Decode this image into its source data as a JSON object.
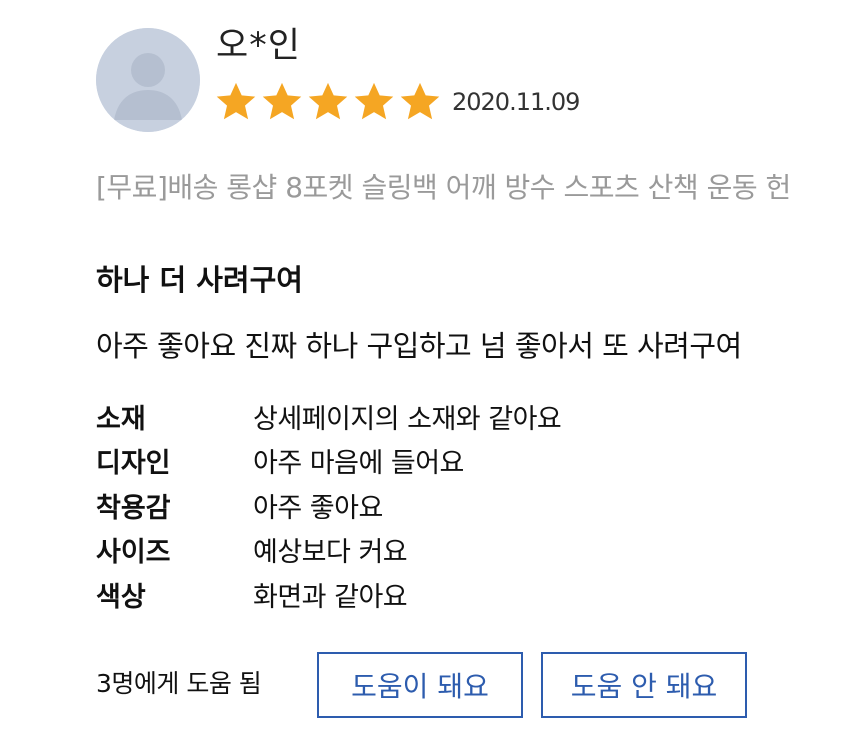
{
  "review": {
    "user_name": "오*인",
    "rating": 5,
    "max_rating": 5,
    "date": "2020.11.09",
    "product_name": "[무료]배송 롱샵 8포켓 슬링백 어깨 방수 스포츠 산책 운동 헌",
    "headline": "하나 더 사려구여",
    "body": "아주 좋아요 진짜 하나 구입하고 넘 좋아서 또 사려구여",
    "survey": [
      {
        "label": "소재",
        "answer": "상세페이지의 소재와 같아요"
      },
      {
        "label": "디자인",
        "answer": "아주 마음에 들어요"
      },
      {
        "label": "착용감",
        "answer": "아주 좋아요"
      },
      {
        "label": "사이즈",
        "answer": "예상보다 커요"
      },
      {
        "label": "색상",
        "answer": "화면과 같아요"
      }
    ],
    "help_count_text": "3명에게 도움 됨",
    "helpful_button": "도움이 돼요",
    "not_helpful_button": "도움 안 돼요"
  },
  "colors": {
    "star": "#f5a623",
    "button_blue": "#2d5cae",
    "product_gray": "#9a9a9a",
    "avatar_bg": "#c7d0df"
  },
  "icons": {
    "avatar": "user-silhouette",
    "star": "filled-star"
  }
}
